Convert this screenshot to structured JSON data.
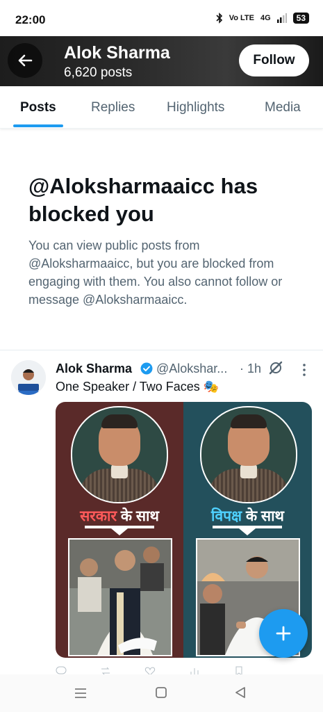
{
  "status_bar": {
    "time": "22:00",
    "network": "Vo LTE",
    "signal": "4G",
    "battery": "53"
  },
  "header": {
    "name": "Alok Sharma",
    "posts_count": "6,620 posts",
    "follow_label": "Follow"
  },
  "tabs": [
    {
      "label": "Posts",
      "active": true
    },
    {
      "label": "Replies"
    },
    {
      "label": "Highlights"
    },
    {
      "label": "Media"
    }
  ],
  "blocked": {
    "title": "@Aloksharmaaicc has blocked you",
    "description": "You can view public posts from @Aloksharmaaicc, but you are blocked from engaging with them. You also cannot follow or message @Aloksharmaaicc."
  },
  "post": {
    "author": "Alok Sharma",
    "handle": "@Alokshar...",
    "time": "· 1h",
    "text": "One Speaker / Two Faces 🎭",
    "image": {
      "left_caption_highlight": "सरकार",
      "left_caption_rest": " के साथ",
      "right_caption_highlight": "विपक्ष",
      "right_caption_rest": " के साथ"
    }
  },
  "icons": [
    "back-arrow-icon",
    "verified-badge-icon",
    "grok-icon",
    "more-icon",
    "plus-icon"
  ],
  "colors": {
    "accent": "#1d9bf0",
    "text": "#0f1419",
    "muted": "#536471"
  }
}
